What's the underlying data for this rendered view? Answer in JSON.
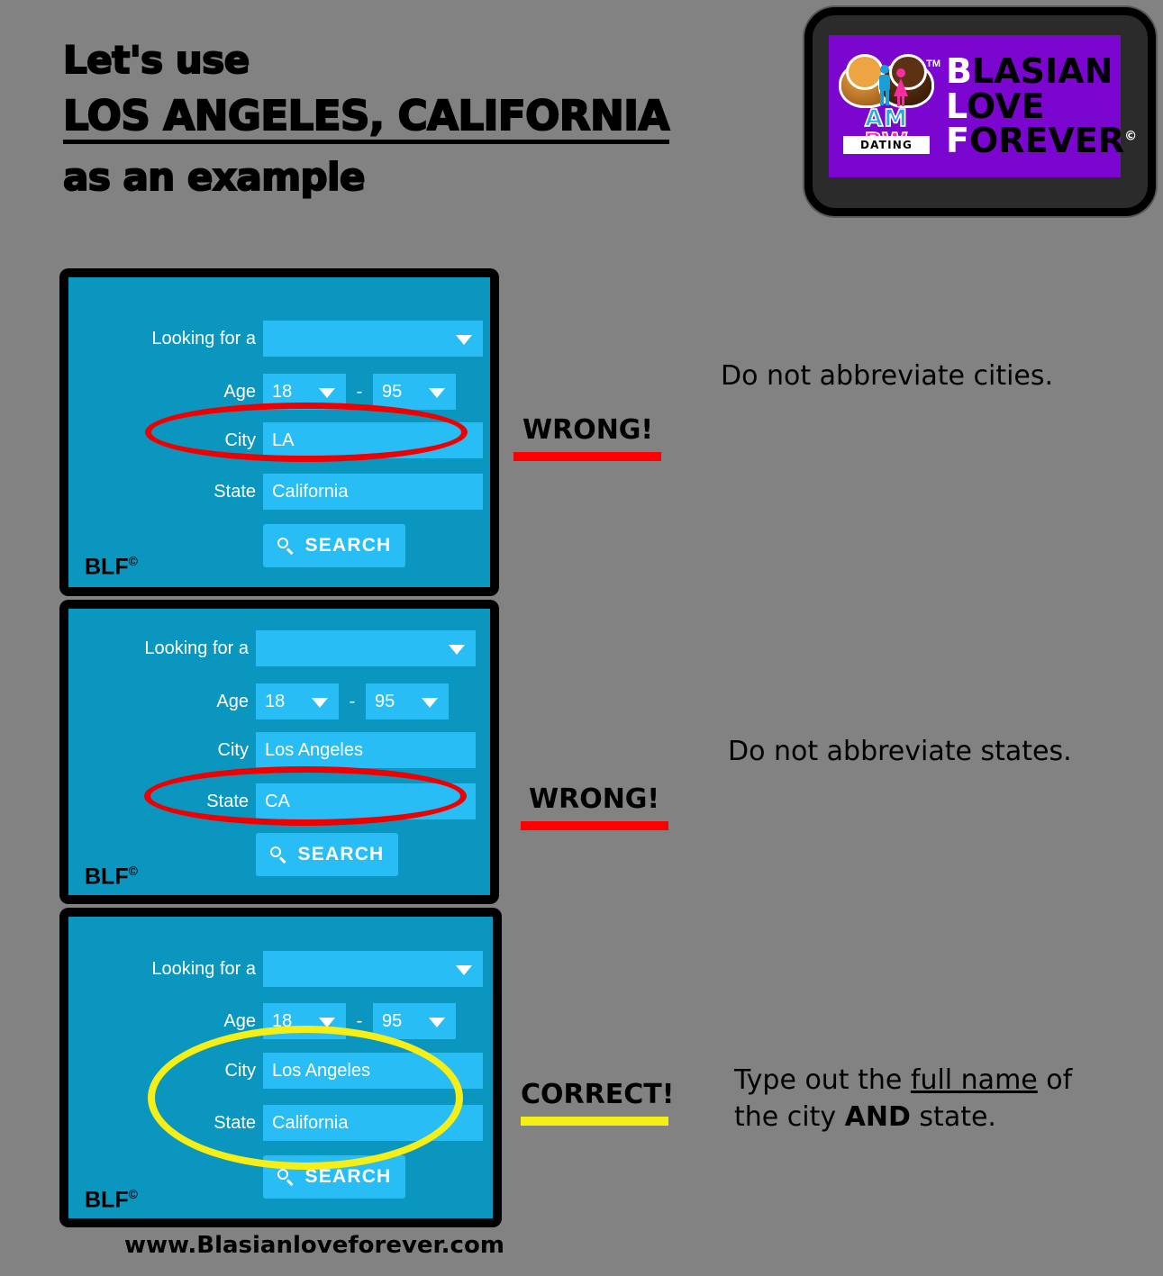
{
  "headline": {
    "line1": "Let's use",
    "line2": "LOS ANGELES, CALIFORNIA",
    "line3": "as an example"
  },
  "logo": {
    "badge": {
      "am": "AM",
      "bw": "BW",
      "dating": "DATING",
      "tm": "TM"
    },
    "words": {
      "row1_cap": "B",
      "row1_rest": "LASIAN",
      "row2_cap": "L",
      "row2_rest": "OVE",
      "row3_cap": "F",
      "row3_rest": "OREVER",
      "copyright": "©"
    },
    "colors": {
      "card_bg": "#7b06cf",
      "frame": "#2b2b2b"
    }
  },
  "form_labels": {
    "looking_for": "Looking for a",
    "age": "Age",
    "city": "City",
    "state": "State",
    "dash": "-",
    "search": "SEARCH",
    "blf": "BLF"
  },
  "panels": [
    {
      "id": "panel-1",
      "looking_for_value": "",
      "age_min": "18",
      "age_max": "95",
      "city_value": "LA",
      "state_value": "California",
      "highlight": "city",
      "highlight_color": "#ee0000"
    },
    {
      "id": "panel-2",
      "looking_for_value": "",
      "age_min": "18",
      "age_max": "95",
      "city_value": "Los Angeles",
      "state_value": "CA",
      "highlight": "state",
      "highlight_color": "#ee0000"
    },
    {
      "id": "panel-3",
      "looking_for_value": "",
      "age_min": "18",
      "age_max": "95",
      "city_value": "Los Angeles",
      "state_value": "California",
      "highlight": "city-and-state",
      "highlight_color": "#f5ef16"
    }
  ],
  "annotations": [
    {
      "verdict": "WRONG!",
      "bar_color": "#ff0000",
      "note": "Do not abbreviate cities."
    },
    {
      "verdict": "WRONG!",
      "bar_color": "#ff0000",
      "note": "Do not abbreviate states."
    },
    {
      "verdict": "CORRECT!",
      "bar_color": "#f5ef16",
      "note_part1": "Type out the ",
      "note_underlined": "full name",
      "note_part2": " of",
      "note_line2_part1": "the city ",
      "note_bold": "AND",
      "note_line2_part2": " state."
    }
  ],
  "footer": {
    "url": "www.Blasianloveforever.com"
  },
  "theme": {
    "page_bg": "#828282",
    "panel_border": "#000000",
    "panel_bg": "#0b96c0",
    "field_bg": "#29bdf5",
    "field_text": "#ffffff"
  }
}
